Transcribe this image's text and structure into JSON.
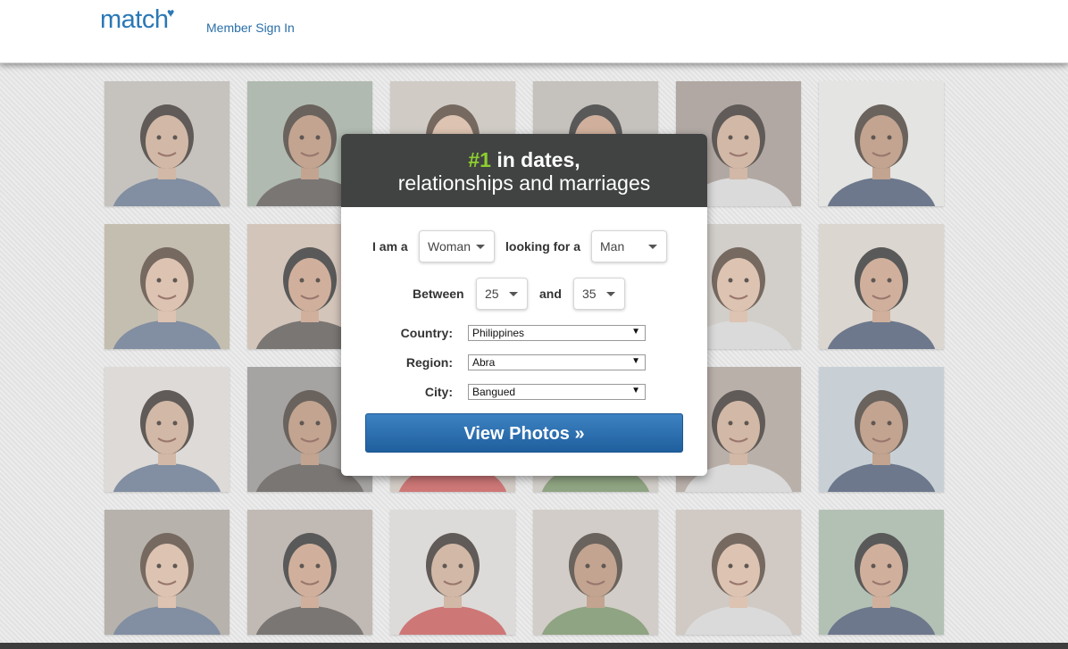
{
  "header": {
    "logo_text": "match",
    "logo_icon": "heart-icon",
    "sign_in_label": "Member Sign In"
  },
  "colors": {
    "brand_blue": "#2a78b5",
    "accent_green": "#8ccf2e",
    "modal_header": "#414242",
    "button_blue": "#2c6fb0"
  },
  "photos": [
    "profile-photo",
    "profile-photo",
    "profile-photo",
    "profile-photo",
    "profile-photo",
    "profile-photo",
    "profile-photo",
    "profile-photo",
    "profile-photo",
    "profile-photo",
    "profile-photo",
    "profile-photo",
    "profile-photo",
    "profile-photo",
    "profile-photo",
    "profile-photo",
    "profile-photo",
    "profile-photo",
    "profile-photo",
    "profile-photo",
    "profile-photo",
    "profile-photo",
    "profile-photo",
    "profile-photo"
  ],
  "modal": {
    "headline_accent": "#1",
    "headline_rest": " in dates,",
    "headline_line2": "relationships and marriages",
    "i_am_label": "I am a",
    "gender_value": "Woman",
    "looking_for_label": "looking for a",
    "seeking_value": "Man",
    "between_label": "Between",
    "age_min": "25",
    "and_label": "and",
    "age_max": "35",
    "country_label": "Country:",
    "country_value": "Philippines",
    "region_label": "Region:",
    "region_value": "Abra",
    "city_label": "City:",
    "city_value": "Bangued",
    "cta_label": "View Photos »"
  }
}
